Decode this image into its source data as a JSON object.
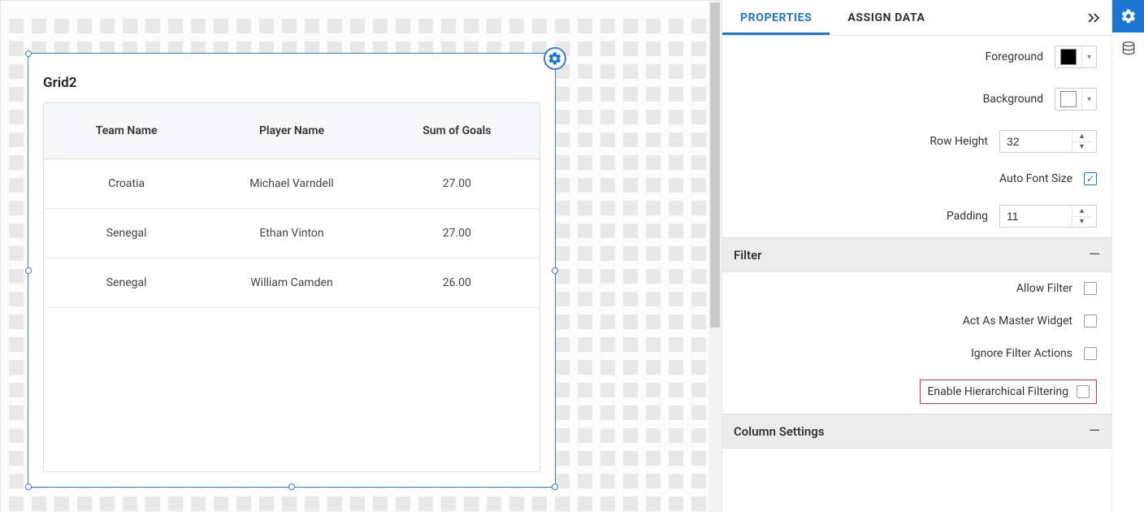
{
  "widget": {
    "title": "Grid2",
    "columns": [
      "Team Name",
      "Player Name",
      "Sum of Goals"
    ],
    "rows": [
      {
        "c0": "Croatia",
        "c1": "Michael Varndell",
        "c2": "27.00"
      },
      {
        "c0": "Senegal",
        "c1": "Ethan Vinton",
        "c2": "27.00"
      },
      {
        "c0": "Senegal",
        "c1": "William Camden",
        "c2": "26.00"
      }
    ]
  },
  "tabs": {
    "properties": "PROPERTIES",
    "assign_data": "ASSIGN DATA"
  },
  "props": {
    "foreground_label": "Foreground",
    "foreground_color": "#000000",
    "background_label": "Background",
    "background_color": "#ffffff",
    "row_height_label": "Row Height",
    "row_height_value": "32",
    "auto_font_label": "Auto Font Size",
    "auto_font_checked": true,
    "padding_label": "Padding",
    "padding_value": "11"
  },
  "sections": {
    "filter": "Filter",
    "column_settings": "Column Settings"
  },
  "filter": {
    "allow_filter_label": "Allow Filter",
    "allow_filter_checked": false,
    "master_widget_label": "Act As Master Widget",
    "master_widget_checked": false,
    "ignore_actions_label": "Ignore Filter Actions",
    "ignore_actions_checked": false,
    "hierarchical_label": "Enable Hierarchical Filtering",
    "hierarchical_checked": false
  }
}
